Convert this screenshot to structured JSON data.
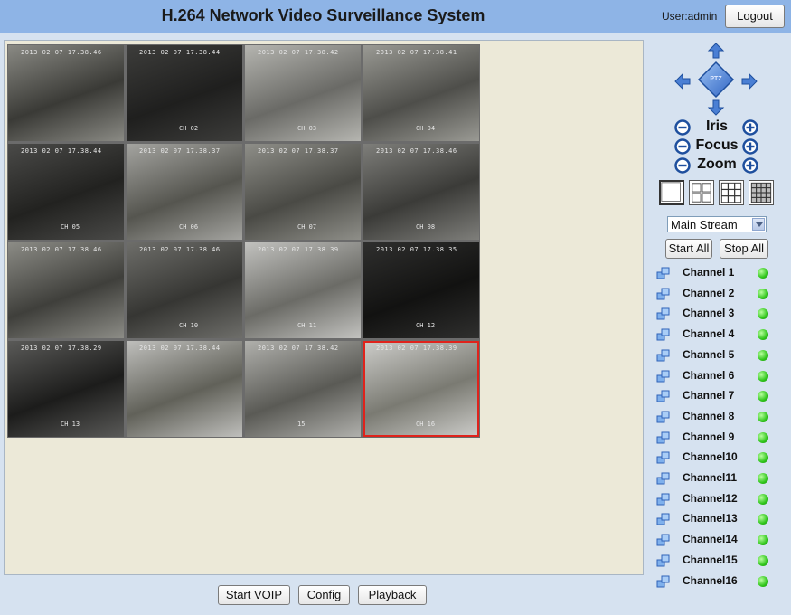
{
  "header": {
    "title": "H.264 Network Video Surveillance System",
    "user": "User:admin",
    "logout_label": "Logout"
  },
  "cameras": [
    {
      "ts": "2013 02 07 17.38.46",
      "ch": ""
    },
    {
      "ts": "2013 02 07 17.38.44",
      "ch": "CH 02"
    },
    {
      "ts": "2013 02 07 17.38.42",
      "ch": "CH 03"
    },
    {
      "ts": "2013 02 07 17.38.41",
      "ch": "CH 04"
    },
    {
      "ts": "2013 02 07 17.38.44",
      "ch": "CH 05"
    },
    {
      "ts": "2013 02 07 17.38.37",
      "ch": "CH 06"
    },
    {
      "ts": "2013 02 07 17.38.37",
      "ch": "CH 07"
    },
    {
      "ts": "2013 02 07 17.38.46",
      "ch": "CH 08"
    },
    {
      "ts": "2013 02 07 17.38.46",
      "ch": ""
    },
    {
      "ts": "2013 02 07 17.38.46",
      "ch": "CH 10"
    },
    {
      "ts": "2013 02 07 17.38.39",
      "ch": "CH 11"
    },
    {
      "ts": "2013 02 07 17.38.35",
      "ch": "CH 12"
    },
    {
      "ts": "2013 02 07 17.38.29",
      "ch": "CH 13"
    },
    {
      "ts": "2013 02 07 17.38.44",
      "ch": ""
    },
    {
      "ts": "2013 02 07 17.38.42",
      "ch": "15"
    },
    {
      "ts": "2013 02 07 17.38.39",
      "ch": "CH 16"
    }
  ],
  "camera_selected_index": 15,
  "bottom_buttons": {
    "start_voip": "Start VOIP",
    "config": "Config",
    "playback": "Playback"
  },
  "ptz": {
    "center_label": "PTZ",
    "iris": "Iris",
    "focus": "Focus",
    "zoom": "Zoom"
  },
  "stream": {
    "selected": "Main Stream"
  },
  "controls": {
    "start_all": "Start All",
    "stop_all": "Stop All"
  },
  "channels": [
    {
      "label": "Channel 1"
    },
    {
      "label": "Channel 2"
    },
    {
      "label": "Channel 3"
    },
    {
      "label": "Channel 4"
    },
    {
      "label": "Channel 5"
    },
    {
      "label": "Channel 6"
    },
    {
      "label": "Channel 7"
    },
    {
      "label": "Channel 8"
    },
    {
      "label": "Channel 9"
    },
    {
      "label": "Channel10"
    },
    {
      "label": "Channel11"
    },
    {
      "label": "Channel12"
    },
    {
      "label": "Channel13"
    },
    {
      "label": "Channel14"
    },
    {
      "label": "Channel15"
    },
    {
      "label": "Channel16"
    }
  ],
  "colors": {
    "header_bg": "#8eb4e6",
    "status_online": "#2fc51a",
    "selection": "#e0231c"
  }
}
